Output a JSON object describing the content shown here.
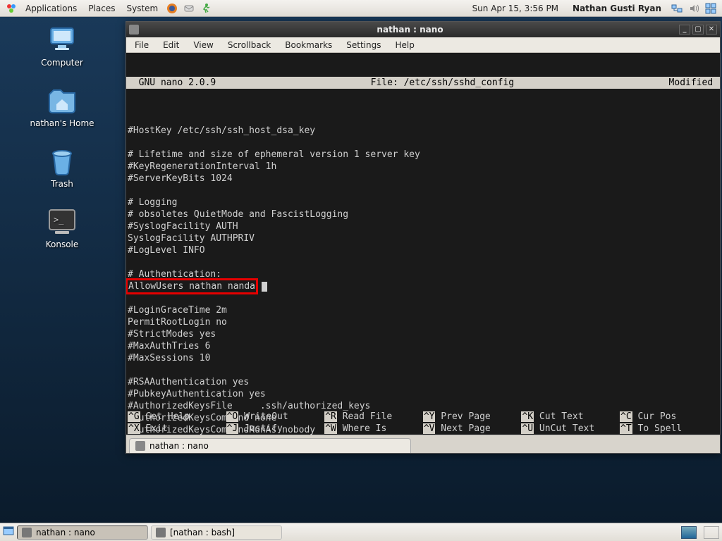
{
  "panel": {
    "menus": [
      "Applications",
      "Places",
      "System"
    ],
    "clock": "Sun Apr 15,  3:56 PM",
    "username": "Nathan Gusti Ryan"
  },
  "desktop": {
    "icons": [
      {
        "label": "Computer",
        "id": "computer"
      },
      {
        "label": "nathan's Home",
        "id": "home"
      },
      {
        "label": "Trash",
        "id": "trash"
      },
      {
        "label": "Konsole",
        "id": "konsole"
      }
    ]
  },
  "window": {
    "title": "nathan : nano",
    "menus": [
      "File",
      "Edit",
      "View",
      "Scrollback",
      "Bookmarks",
      "Settings",
      "Help"
    ],
    "tab": "nathan : nano"
  },
  "nano": {
    "app": "  GNU nano 2.0.9",
    "file": "File: /etc/ssh/sshd_config",
    "status": "Modified ",
    "lines": [
      "",
      "#HostKey /etc/ssh/ssh_host_dsa_key",
      "",
      "# Lifetime and size of ephemeral version 1 server key",
      "#KeyRegenerationInterval 1h",
      "#ServerKeyBits 1024",
      "",
      "# Logging",
      "# obsoletes QuietMode and FascistLogging",
      "#SyslogFacility AUTH",
      "SyslogFacility AUTHPRIV",
      "#LogLevel INFO",
      "",
      "# Authentication:"
    ],
    "highlight": "AllowUsers nathan nanda",
    "lines_after": [
      "",
      "#LoginGraceTime 2m",
      "PermitRootLogin no",
      "#StrictModes yes",
      "#MaxAuthTries 6",
      "#MaxSessions 10",
      "",
      "#RSAAuthentication yes",
      "#PubkeyAuthentication yes",
      "#AuthorizedKeysFile     .ssh/authorized_keys",
      "#AuthorizedKeysCommand none",
      "#AuthorizedKeysCommandRunAs nobody",
      ""
    ],
    "footer": [
      [
        {
          "k": "^G",
          "t": " Get Help"
        },
        {
          "k": "^O",
          "t": " WriteOut"
        },
        {
          "k": "^R",
          "t": " Read File"
        },
        {
          "k": "^Y",
          "t": " Prev Page"
        },
        {
          "k": "^K",
          "t": " Cut Text"
        },
        {
          "k": "^C",
          "t": " Cur Pos"
        }
      ],
      [
        {
          "k": "^X",
          "t": " Exit"
        },
        {
          "k": "^J",
          "t": " Justify"
        },
        {
          "k": "^W",
          "t": " Where Is"
        },
        {
          "k": "^V",
          "t": " Next Page"
        },
        {
          "k": "^U",
          "t": " UnCut Text"
        },
        {
          "k": "^T",
          "t": " To Spell"
        }
      ]
    ]
  },
  "taskbar": {
    "tasks": [
      {
        "label": "nathan : nano",
        "active": true
      },
      {
        "label": "[nathan : bash]",
        "active": false
      }
    ]
  }
}
